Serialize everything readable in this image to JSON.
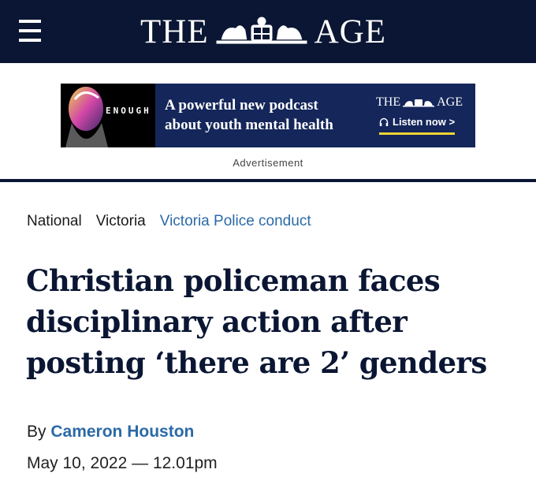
{
  "masthead": {
    "title_left": "THE",
    "title_right": "AGE",
    "icons": {
      "menu": "menu-icon",
      "crest": "coat-of-arms-icon"
    },
    "background": "#0a1633"
  },
  "ad": {
    "art_text": "ENOUGH",
    "headline_line1": "A powerful new podcast",
    "headline_line2": "about youth mental health",
    "brand_left": "THE",
    "brand_right": "AGE",
    "cta": "Listen now >",
    "label": "Advertisement",
    "colors": {
      "background": "#14265a",
      "accent": "#f3d334"
    }
  },
  "breadcrumb": {
    "items": [
      "National",
      "Victoria"
    ],
    "topic": "Victoria Police conduct"
  },
  "article": {
    "headline": "Christian policeman faces disciplinary action after posting ‘there are 2’ genders",
    "byline_prefix": "By",
    "author": "Cameron Houston",
    "date": "May 10, 2022",
    "separator": "—",
    "time": "12.01pm"
  },
  "colors": {
    "link": "#2b6aa7",
    "headline": "#0a1633"
  }
}
